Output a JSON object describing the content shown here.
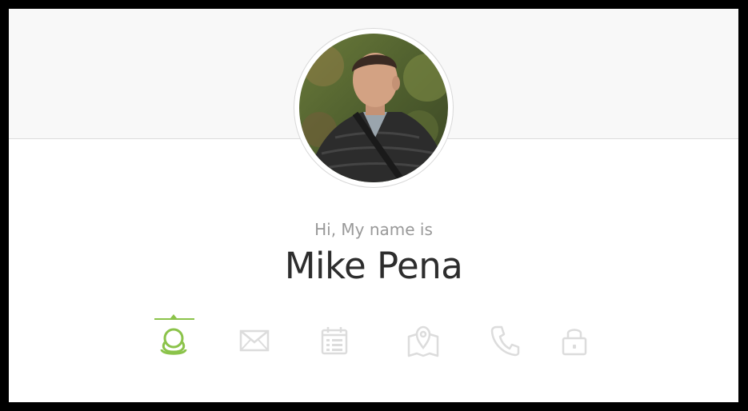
{
  "profile": {
    "greeting": "Hi, My name is",
    "name": "Mike Pena"
  },
  "tabs": [
    {
      "icon": "user-icon",
      "active": true
    },
    {
      "icon": "envelope-icon",
      "active": false
    },
    {
      "icon": "calendar-icon",
      "active": false
    },
    {
      "icon": "map-icon",
      "active": false
    },
    {
      "icon": "phone-icon",
      "active": false
    },
    {
      "icon": "lock-icon",
      "active": false
    }
  ],
  "colors": {
    "accent": "#8bc34a",
    "inactive_icon": "#dcdcdc",
    "greeting_text": "#999999",
    "name_text": "#2d2d2d",
    "header_bg": "#f8f8f8"
  }
}
